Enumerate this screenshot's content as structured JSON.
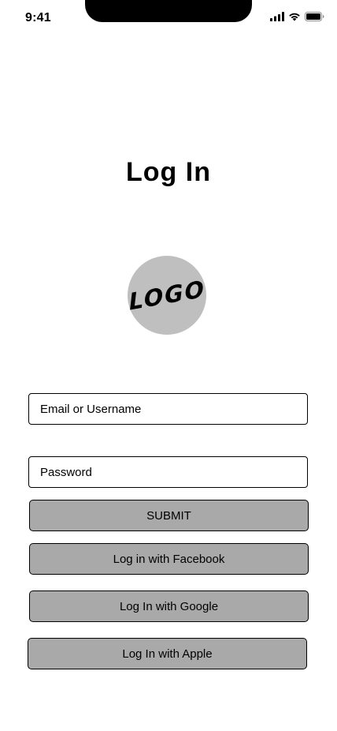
{
  "status_bar": {
    "time": "9:41",
    "icons": [
      "signal-icon",
      "wifi-icon",
      "battery-icon"
    ]
  },
  "title": "Log In",
  "logo": {
    "text": "LOGO",
    "background_color": "#bfbfbf"
  },
  "form": {
    "email_placeholder": "Email or Username",
    "password_placeholder": "Password",
    "submit_label": "SUBMIT"
  },
  "social": {
    "facebook_label": "Log in with Facebook",
    "google_label": "Log In with Google",
    "apple_label": "Log In with Apple"
  },
  "colors": {
    "button_fill": "#a9a9a9",
    "border": "#000000",
    "background": "#ffffff"
  }
}
